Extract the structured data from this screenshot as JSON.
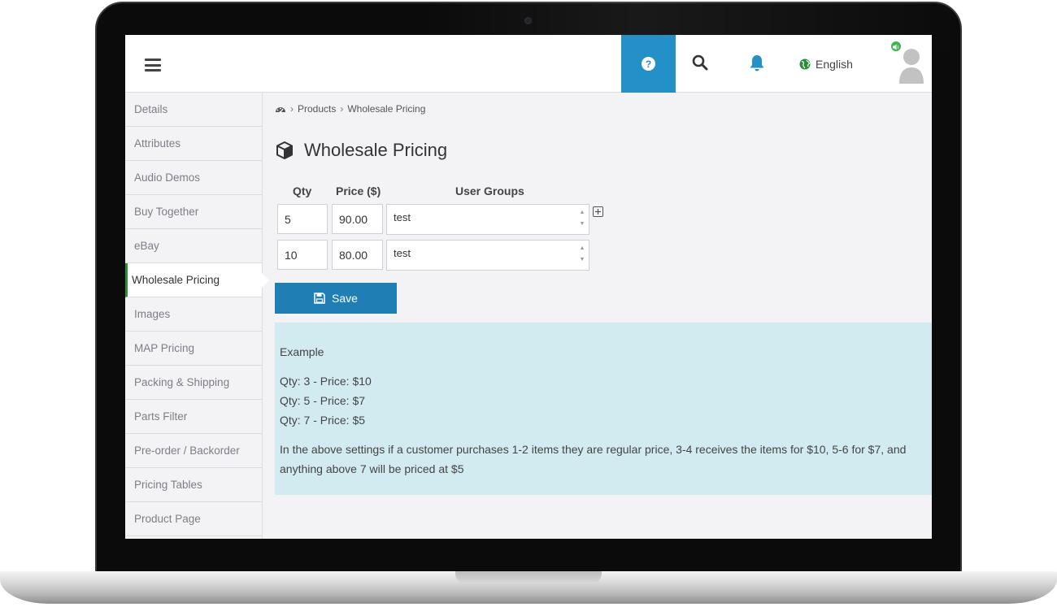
{
  "header": {
    "language": "English"
  },
  "breadcrumb": {
    "items": [
      "Products",
      "Wholesale Pricing"
    ]
  },
  "sidebar": {
    "items": [
      {
        "label": "Details"
      },
      {
        "label": "Attributes"
      },
      {
        "label": "Audio Demos"
      },
      {
        "label": "Buy Together"
      },
      {
        "label": "eBay"
      },
      {
        "label": "Wholesale Pricing",
        "active": true
      },
      {
        "label": "Images"
      },
      {
        "label": "MAP Pricing"
      },
      {
        "label": "Packing & Shipping"
      },
      {
        "label": "Parts Filter"
      },
      {
        "label": "Pre-order / Backorder"
      },
      {
        "label": "Pricing Tables"
      },
      {
        "label": "Product Page"
      }
    ]
  },
  "page": {
    "title": "Wholesale Pricing"
  },
  "pricing_table": {
    "headers": {
      "qty": "Qty",
      "price": "Price ($)",
      "groups": "User Groups"
    },
    "rows": [
      {
        "qty": "5",
        "price": "90.00",
        "group": "test"
      },
      {
        "qty": "10",
        "price": "80.00",
        "group": "test"
      }
    ],
    "save_label": "Save"
  },
  "example": {
    "heading": "Example",
    "lines": [
      "Qty: 3 - Price: $10",
      "Qty: 5 - Price: $7",
      "Qty: 7 - Price: $5"
    ],
    "description": "In the above settings if a customer purchases 1-2 items they are regular price, 3-4 receives the items for $10, 5-6 for $7, and anything above 7 will be priced at $5"
  },
  "colors": {
    "accent": "#2490c8",
    "save_button": "#1f7fb5",
    "example_bg": "#d1ebf0",
    "active_marker": "#2a8f3a",
    "online_status": "#3cb54a"
  }
}
